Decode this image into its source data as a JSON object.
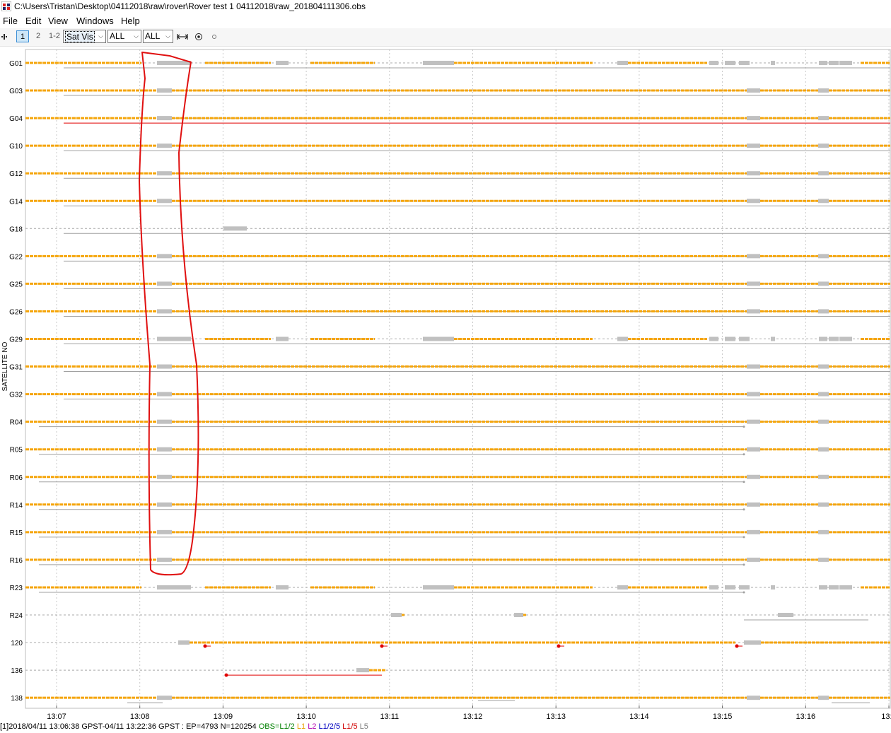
{
  "window": {
    "title": "C:\\Users\\Tristan\\Desktop\\04112018\\raw\\rover\\Rover test 1 04112018\\raw_201804111306.obs",
    "app_icon": "rtkplot-icon"
  },
  "menu": {
    "file": "File",
    "edit": "Edit",
    "view": "View",
    "windows": "Windows",
    "help": "Help"
  },
  "toolbar": {
    "pan_icon": "pan-icon",
    "btn1": "1",
    "btn2": "2",
    "btn12": "1-2",
    "plot_type": "Sat Vis",
    "sel_a": "ALL",
    "sel_b": "ALL",
    "fit_icon": "fit-horizontal-icon",
    "center_icon": "center-target-icon",
    "point_icon": "point-icon"
  },
  "chart_data": {
    "type": "timeline",
    "ylabel": "SATELLITE NO",
    "x_ticks": [
      "13:07",
      "13:08",
      "13:09",
      "13:10",
      "13:11",
      "13:12",
      "13:13",
      "13:14",
      "13:15",
      "13:16",
      "13:1"
    ],
    "x_range": [
      "13:06:38",
      "13:22:36"
    ],
    "grid": true,
    "colors": {
      "L1/2": "#f5a50a",
      "gap": "#c0c0c0",
      "slip": "#e00000",
      "dashed": "#a8a8a8"
    },
    "satellites": [
      {
        "id": "G01",
        "pattern": "broken",
        "subline": "gray"
      },
      {
        "id": "G03",
        "pattern": "full",
        "subline": "gray"
      },
      {
        "id": "G04",
        "pattern": "full",
        "subline": "red"
      },
      {
        "id": "G10",
        "pattern": "full",
        "subline": "gray"
      },
      {
        "id": "G12",
        "pattern": "full",
        "subline": "gray"
      },
      {
        "id": "G14",
        "pattern": "full",
        "subline": "gray"
      },
      {
        "id": "G18",
        "pattern": "short",
        "subline": "gray"
      },
      {
        "id": "G22",
        "pattern": "full",
        "subline": "gray"
      },
      {
        "id": "G25",
        "pattern": "full",
        "subline": "gray"
      },
      {
        "id": "G26",
        "pattern": "full",
        "subline": "gray"
      },
      {
        "id": "G29",
        "pattern": "broken",
        "subline": "gray"
      },
      {
        "id": "G31",
        "pattern": "full",
        "subline": "gray"
      },
      {
        "id": "G32",
        "pattern": "full",
        "subline": "gray"
      },
      {
        "id": "R04",
        "pattern": "full",
        "subline": "gray-short"
      },
      {
        "id": "R05",
        "pattern": "full",
        "subline": "gray-short"
      },
      {
        "id": "R06",
        "pattern": "full",
        "subline": "gray-short"
      },
      {
        "id": "R14",
        "pattern": "full",
        "subline": "gray-short"
      },
      {
        "id": "R15",
        "pattern": "full",
        "subline": "gray-short"
      },
      {
        "id": "R16",
        "pattern": "full",
        "subline": "gray-short"
      },
      {
        "id": "R23",
        "pattern": "broken",
        "subline": "gray-short"
      },
      {
        "id": "R24",
        "pattern": "sparse",
        "subline": "gray-tail"
      },
      {
        "id": "120",
        "pattern": "sbas",
        "subline": "slips"
      },
      {
        "id": "136",
        "pattern": "sbas-short",
        "subline": "red-span"
      },
      {
        "id": "138",
        "pattern": "full",
        "subline": "gray-bits"
      }
    ]
  },
  "status": {
    "prefix": "[1]",
    "info": "2018/04/11 13:06:38 GPST-04/11 13:22:36 GPST : EP=4793 N=120254",
    "obs": "OBS=L1/2",
    "l1": "L1",
    "l2": "L2",
    "l125": "L1/2/5",
    "l15": "L1/5",
    "l5": "L5",
    "colors": {
      "obs": "#008000",
      "l1": "#e8a000",
      "l2": "#b000b0",
      "l125": "#0000c0",
      "l15": "#d00000",
      "l5": "#808080"
    }
  }
}
